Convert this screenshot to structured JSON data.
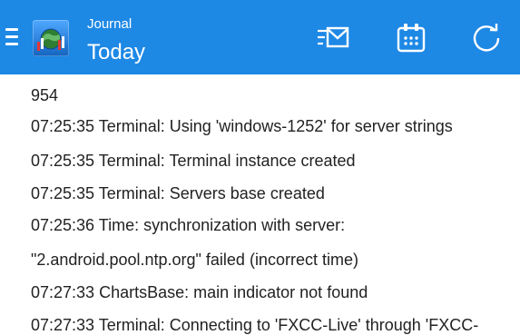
{
  "header": {
    "title_small": "Journal",
    "title_big": "Today",
    "background_color": "#1e88e5",
    "icons": [
      "menu-icon",
      "app-logo-icon",
      "email-icon",
      "calendar-icon",
      "refresh-icon"
    ]
  },
  "journal": {
    "lines": [
      "954",
      "07:25:35 Terminal: Using 'windows-1252' for server strings",
      "07:25:35 Terminal: Terminal instance created",
      "07:25:35 Terminal: Servers base created",
      "07:25:36 Time: synchronization with server:",
      "\"2.android.pool.ntp.org\" failed (incorrect time)",
      "07:27:33 ChartsBase: main indicator not found",
      "07:27:33 Terminal: Connecting to 'FXCC-Live' through 'FXCC-"
    ]
  }
}
